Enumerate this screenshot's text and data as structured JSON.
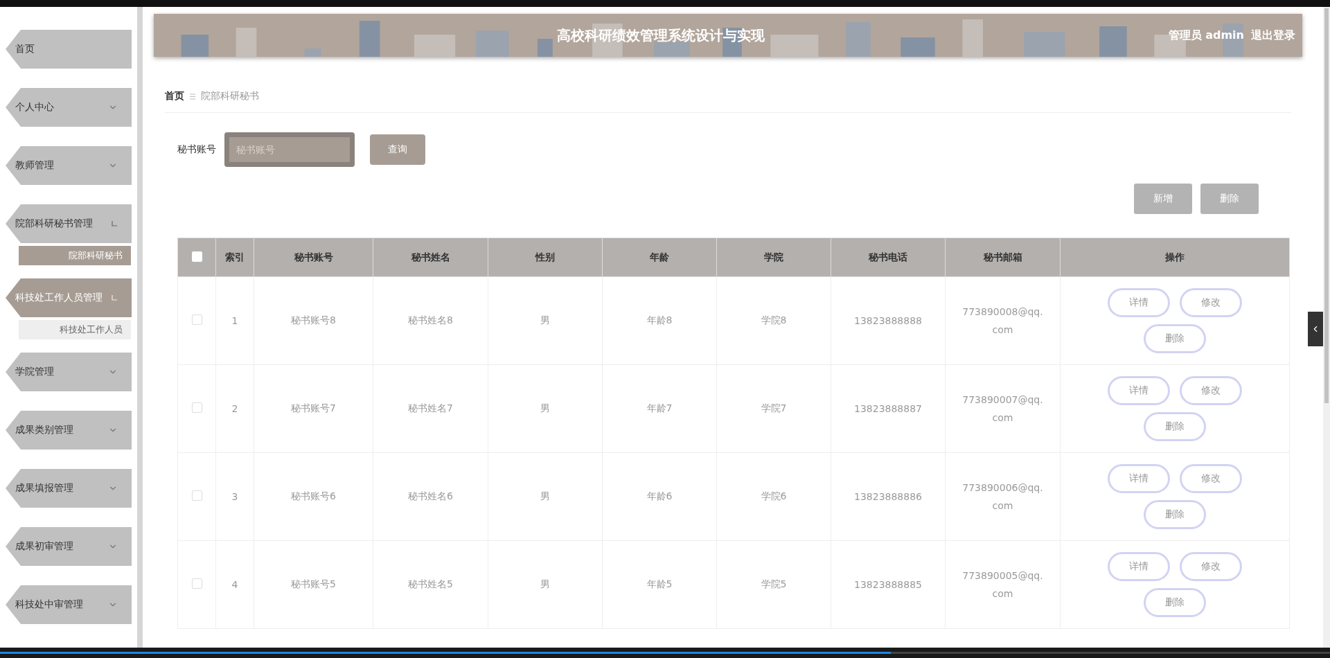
{
  "sidebar": {
    "items": [
      {
        "label": "首页",
        "kind": "link",
        "selected": false
      },
      {
        "label": "个人中心",
        "kind": "menu",
        "selected": false,
        "expanded": false
      },
      {
        "label": "教师管理",
        "kind": "menu",
        "selected": false,
        "expanded": false
      },
      {
        "label": "院部科研秘书管理",
        "kind": "menu",
        "selected": false,
        "expanded": true,
        "children": [
          {
            "label": "院部科研秘书",
            "selected": true
          }
        ]
      },
      {
        "label": "科技处工作人员管理",
        "kind": "menu",
        "selected": true,
        "expanded": true,
        "children": [
          {
            "label": "科技处工作人员",
            "selected": false
          }
        ]
      },
      {
        "label": "学院管理",
        "kind": "menu",
        "selected": false,
        "expanded": false
      },
      {
        "label": "成果类别管理",
        "kind": "menu",
        "selected": false,
        "expanded": false
      },
      {
        "label": "成果填报管理",
        "kind": "menu",
        "selected": false,
        "expanded": false
      },
      {
        "label": "成果初审管理",
        "kind": "menu",
        "selected": false,
        "expanded": false
      },
      {
        "label": "科技处中审管理",
        "kind": "menu",
        "selected": false,
        "expanded": false
      }
    ]
  },
  "header": {
    "title": "高校科研绩效管理系统设计与实现",
    "user": "管理员 admin",
    "logout": "退出登录"
  },
  "breadcrumb": [
    "首页",
    "院部科研秘书"
  ],
  "search": {
    "label": "秘书账号",
    "placeholder": "秘书账号",
    "button": "查询"
  },
  "actions": [
    "新增",
    "删除"
  ],
  "table": {
    "all_selected": false,
    "columns": [
      "索引",
      "秘书账号",
      "秘书姓名",
      "性别",
      "年龄",
      "学院",
      "秘书电话",
      "秘书邮箱",
      "操作"
    ],
    "rows": [
      {
        "selected": false,
        "cells": [
          "1",
          "秘书账号8",
          "秘书姓名8",
          "男",
          "年龄8",
          "学院8",
          "13823888888",
          "773890008@qq.com"
        ],
        "actions": [
          "详情",
          "修改",
          "删除"
        ]
      },
      {
        "selected": false,
        "cells": [
          "2",
          "秘书账号7",
          "秘书姓名7",
          "男",
          "年龄7",
          "学院7",
          "13823888887",
          "773890007@qq.com"
        ],
        "actions": [
          "详情",
          "修改",
          "删除"
        ]
      },
      {
        "selected": false,
        "cells": [
          "3",
          "秘书账号6",
          "秘书姓名6",
          "男",
          "年龄6",
          "学院6",
          "13823888886",
          "773890006@qq.com"
        ],
        "actions": [
          "详情",
          "修改",
          "删除"
        ]
      },
      {
        "selected": false,
        "cells": [
          "4",
          "秘书账号5",
          "秘书姓名5",
          "男",
          "年龄5",
          "学院5",
          "13823888885",
          "773890005@qq.com"
        ],
        "actions": [
          "详情",
          "修改",
          "删除"
        ]
      }
    ]
  },
  "player": {
    "level": 0.67
  }
}
